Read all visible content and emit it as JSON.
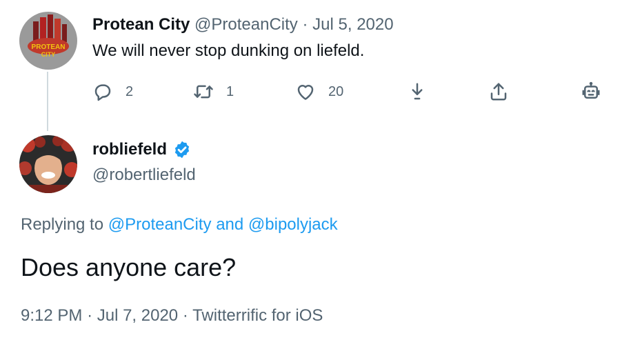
{
  "reply_tweet": {
    "display_name": "Protean City",
    "handle": "@ProteanCity",
    "separator": "·",
    "date": "Jul 5, 2020",
    "text": "We will never stop dunking on liefeld.",
    "avatar_logo_text": "PROTEAN CITY",
    "actions": {
      "reply_count": "2",
      "retweet_count": "1",
      "like_count": "20"
    }
  },
  "main_tweet": {
    "display_name": "robliefeld",
    "handle": "@robertliefeld",
    "replying_prefix": "Replying to",
    "mention_1": "@ProteanCity",
    "mention_joiner": "and",
    "mention_2": "@bipolyjack",
    "text": "Does anyone care?",
    "time": "9:12 PM",
    "meta_sep": "·",
    "date": "Jul 7, 2020",
    "source": "Twitterrific for iOS"
  },
  "colors": {
    "text": "#0f1419",
    "secondary": "#536471",
    "accent": "#1d9bf0",
    "thread_line": "#cfd9de"
  },
  "icons": [
    "reply-icon",
    "retweet-icon",
    "like-icon",
    "download-icon",
    "share-icon",
    "bot-icon",
    "verified-badge-icon"
  ]
}
